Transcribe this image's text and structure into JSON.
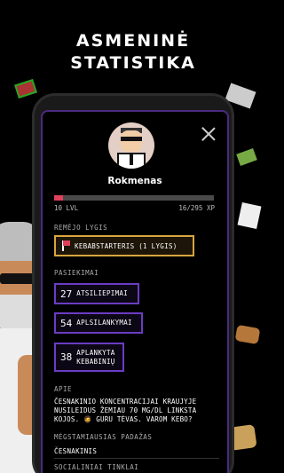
{
  "headline": {
    "line1": "ASMENINĖ",
    "line2": "STATISTIKA"
  },
  "profile": {
    "username": "Rokmenas",
    "level_text": "10 LVL",
    "xp_text": "16/295 XP",
    "xp_progress": 0.054,
    "xp_color": "#e0405a"
  },
  "sponsor": {
    "label": "REMĖJO LYGIS",
    "badge": "KEBABSTARTERIS (1 LYGIS)",
    "badge_border_color": "#d8a640"
  },
  "achievements": {
    "label": "PASIEKIMAI",
    "items": [
      {
        "count": "27",
        "text": "ATSILIEPIMAI"
      },
      {
        "count": "54",
        "text": "APLSILANKYMAI"
      },
      {
        "count": "38",
        "text": "APLANKYTA KEBABINIŲ"
      }
    ],
    "border_color": "#6b3cc4"
  },
  "about": {
    "label": "APIE",
    "text": "ČESNAKINIO KONCENTRACIJAI KRAUJYJE NUSILEIDUS ŽEMIAU 70 MG/DL LINKSTA KOJOS. 🧔 GURU TĖVAS. VAROM KEBO?"
  },
  "favourite_sauce": {
    "label": "MĖGSTAMIAUSIAS PADAŽAS",
    "value": "ČESNAKINIS"
  },
  "next_section_label": "SOCIALINIAI TINKLAI"
}
